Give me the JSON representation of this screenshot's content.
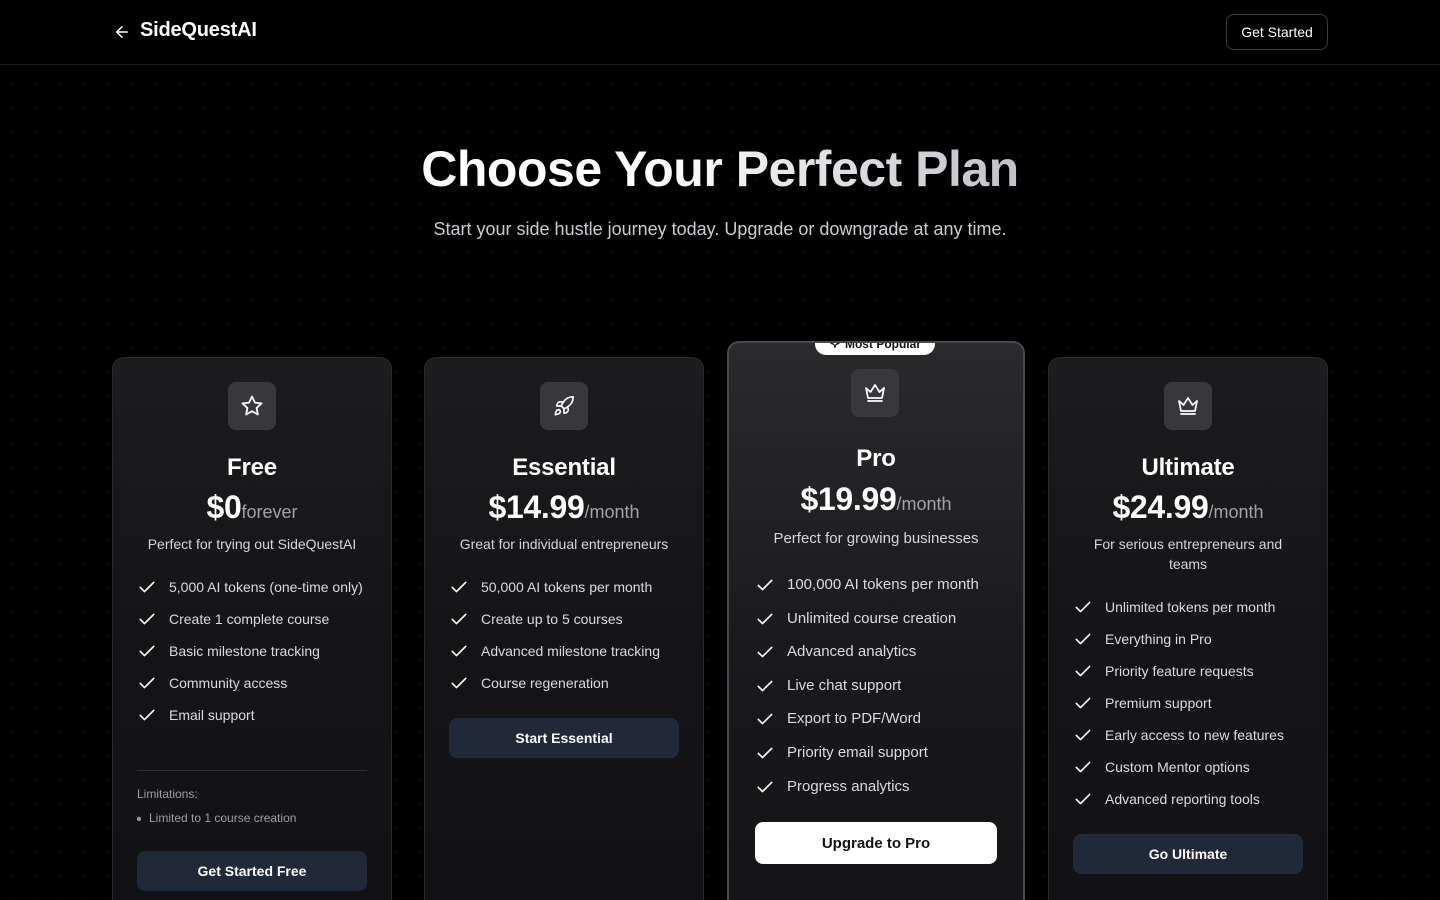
{
  "header": {
    "brand": "SideQuestAI",
    "get_started_label": "Get Started"
  },
  "hero": {
    "title": "Choose Your Perfect Plan",
    "subtitle": "Start your side hustle journey today. Upgrade or downgrade at any time."
  },
  "plans": [
    {
      "name": "Free",
      "icon": "star-icon",
      "price": "$0",
      "period": "forever",
      "description": "Perfect for trying out SideQuestAI",
      "features": [
        "5,000 AI tokens (one-time only)",
        "Create 1 complete course",
        "Basic milestone tracking",
        "Community access",
        "Email support"
      ],
      "limitations_title": "Limitations:",
      "limitations": [
        "Limited to 1 course creation"
      ],
      "cta": "Get Started Free"
    },
    {
      "name": "Essential",
      "icon": "rocket-icon",
      "price": "$14.99",
      "period": "/month",
      "description": "Great for individual entrepreneurs",
      "features": [
        "50,000 AI tokens per month",
        "Create up to 5 courses",
        "Advanced milestone tracking",
        "Course regeneration"
      ],
      "cta": "Start Essential"
    },
    {
      "name": "Pro",
      "icon": "crown-icon",
      "badge": "Most Popular",
      "price": "$19.99",
      "period": "/month",
      "description": "Perfect for growing businesses",
      "features": [
        "100,000 AI tokens per month",
        "Unlimited course creation",
        "Advanced analytics",
        "Live chat support",
        "Export to PDF/Word",
        "Priority email support",
        "Progress analytics"
      ],
      "cta": "Upgrade to Pro"
    },
    {
      "name": "Ultimate",
      "icon": "crown-icon",
      "price": "$24.99",
      "period": "/month",
      "description": "For serious entrepreneurs and teams",
      "features": [
        "Unlimited tokens per month",
        "Everything in Pro",
        "Priority feature requests",
        "Premium support",
        "Early access to new features",
        "Custom Mentor options",
        "Advanced reporting tools"
      ],
      "cta": "Go Ultimate"
    }
  ]
}
